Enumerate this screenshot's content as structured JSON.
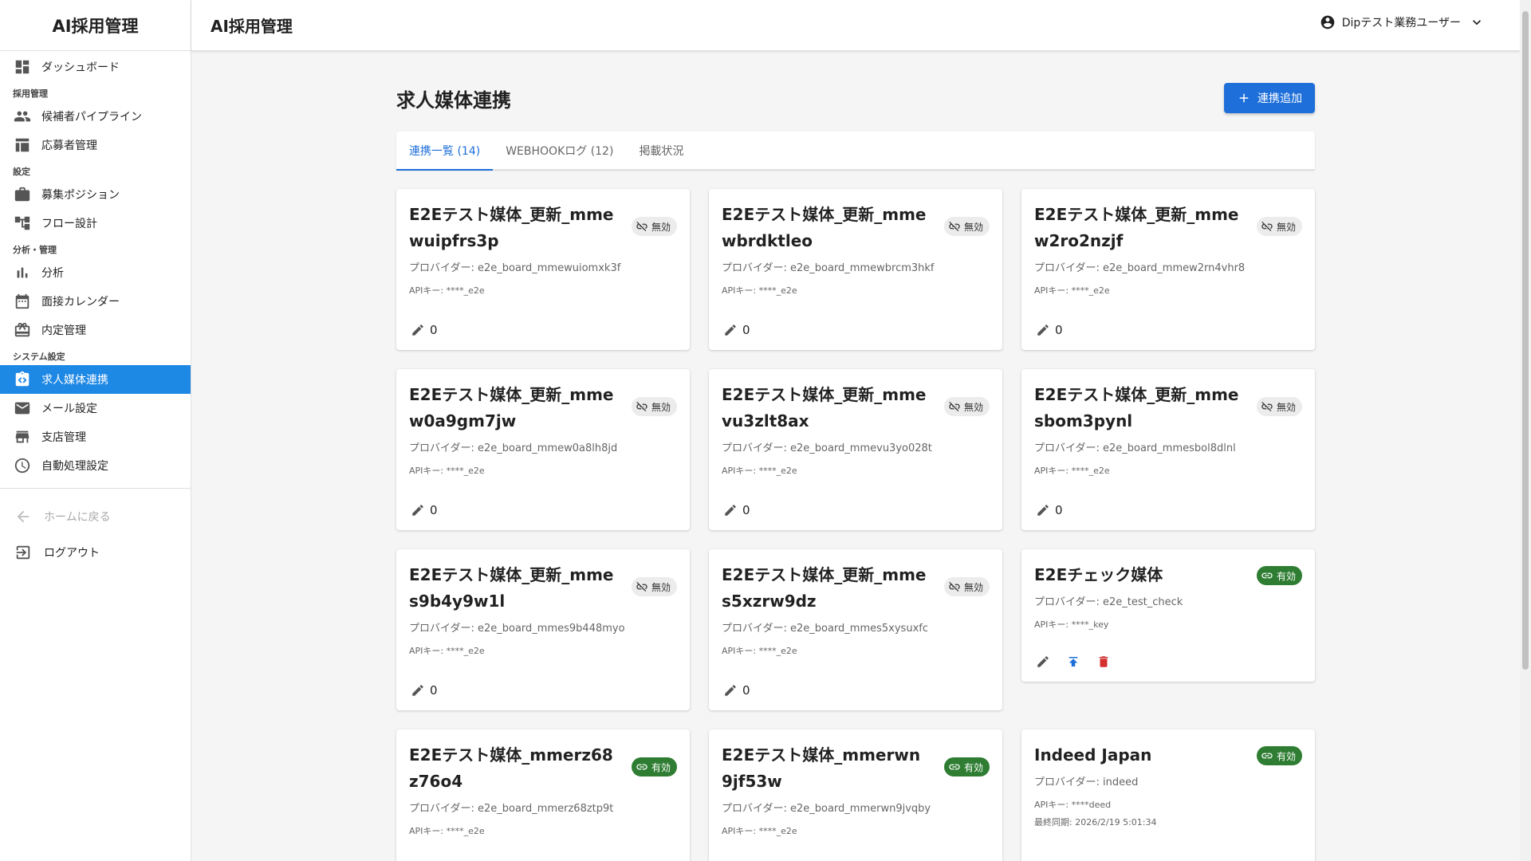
{
  "app": {
    "sidebar_title": "AI採用管理",
    "header_title": "AI採用管理"
  },
  "user": {
    "name": "Dipテスト業務ユーザー"
  },
  "sidebar": {
    "dashboard": "ダッシュボード",
    "sections": {
      "recruit": "採用管理",
      "settings": "設定",
      "analysis": "分析・管理",
      "system": "システム設定"
    },
    "items": {
      "pipeline": "候補者パイプライン",
      "applicants": "応募者管理",
      "positions": "募集ポジション",
      "flow": "フロー設計",
      "analytics": "分析",
      "calendar": "面接カレンダー",
      "offers": "内定管理",
      "job_boards": "求人媒体連携",
      "mail": "メール設定",
      "branches": "支店管理",
      "automation": "自動処理設定"
    },
    "home": "ホームに戻る",
    "logout": "ログアウト"
  },
  "page": {
    "title": "求人媒体連携",
    "add_label": "連携追加",
    "tabs": [
      "連携一覧 (14)",
      "WEBHOOKログ (12)",
      "掲載状況"
    ]
  },
  "status": {
    "off": "無効",
    "on": "有効"
  },
  "colors": {
    "primary": "#1e6fd9",
    "active_nav": "#1e88e5",
    "enabled": "#2e7d32",
    "danger": "#d32f2f"
  },
  "cards": [
    {
      "name": "E2Eテスト媒体_更新_mmewuipfrs3p",
      "status": "無効",
      "provider": "プロバイダー: e2e_board_mmewuiomxk3f",
      "api_key": "APIキー: ****_e2e",
      "count": "0"
    },
    {
      "name": "E2Eテスト媒体_更新_mmewbrdktleo",
      "status": "無効",
      "provider": "プロバイダー: e2e_board_mmewbrcm3hkf",
      "api_key": "APIキー: ****_e2e",
      "count": "0"
    },
    {
      "name": "E2Eテスト媒体_更新_mmew2ro2nzjf",
      "status": "無効",
      "provider": "プロバイダー: e2e_board_mmew2rn4vhr8",
      "api_key": "APIキー: ****_e2e",
      "count": "0"
    },
    {
      "name": "E2Eテスト媒体_更新_mmew0a9gm7jw",
      "status": "無効",
      "provider": "プロバイダー: e2e_board_mmew0a8lh8jd",
      "api_key": "APIキー: ****_e2e",
      "count": "0"
    },
    {
      "name": "E2Eテスト媒体_更新_mmevu3zlt8ax",
      "status": "無効",
      "provider": "プロバイダー: e2e_board_mmevu3yo028t",
      "api_key": "APIキー: ****_e2e",
      "count": "0"
    },
    {
      "name": "E2Eテスト媒体_更新_mmesbom3pynl",
      "status": "無効",
      "provider": "プロバイダー: e2e_board_mmesbol8dlnl",
      "api_key": "APIキー: ****_e2e",
      "count": "0"
    },
    {
      "name": "E2Eテスト媒体_更新_mmes9b4y9w1l",
      "status": "無効",
      "provider": "プロバイダー: e2e_board_mmes9b448myo",
      "api_key": "APIキー: ****_e2e",
      "count": "0"
    },
    {
      "name": "E2Eテスト媒体_更新_mmes5xzrw9dz",
      "status": "無効",
      "provider": "プロバイダー: e2e_board_mmes5xysuxfc",
      "api_key": "APIキー: ****_e2e",
      "count": "0"
    },
    {
      "name": "E2Eチェック媒体",
      "status": "有効",
      "provider": "プロバイダー: e2e_test_check",
      "api_key": "APIキー: ****_key"
    },
    {
      "name": "E2Eテスト媒体_mmerz68z76o4",
      "status": "有効",
      "provider": "プロバイダー: e2e_board_mmerz68ztp9t",
      "api_key": "APIキー: ****_e2e"
    },
    {
      "name": "E2Eテスト媒体_mmerwn9jf53w",
      "status": "有効",
      "provider": "プロバイダー: e2e_board_mmerwn9jvqby",
      "api_key": "APIキー: ****_e2e"
    },
    {
      "name": "Indeed Japan",
      "status": "有効",
      "provider": "プロバイダー: indeed",
      "api_key": "APIキー: ****deed",
      "last_sync": "最終同期: 2026/2/19 5:01:34"
    }
  ]
}
